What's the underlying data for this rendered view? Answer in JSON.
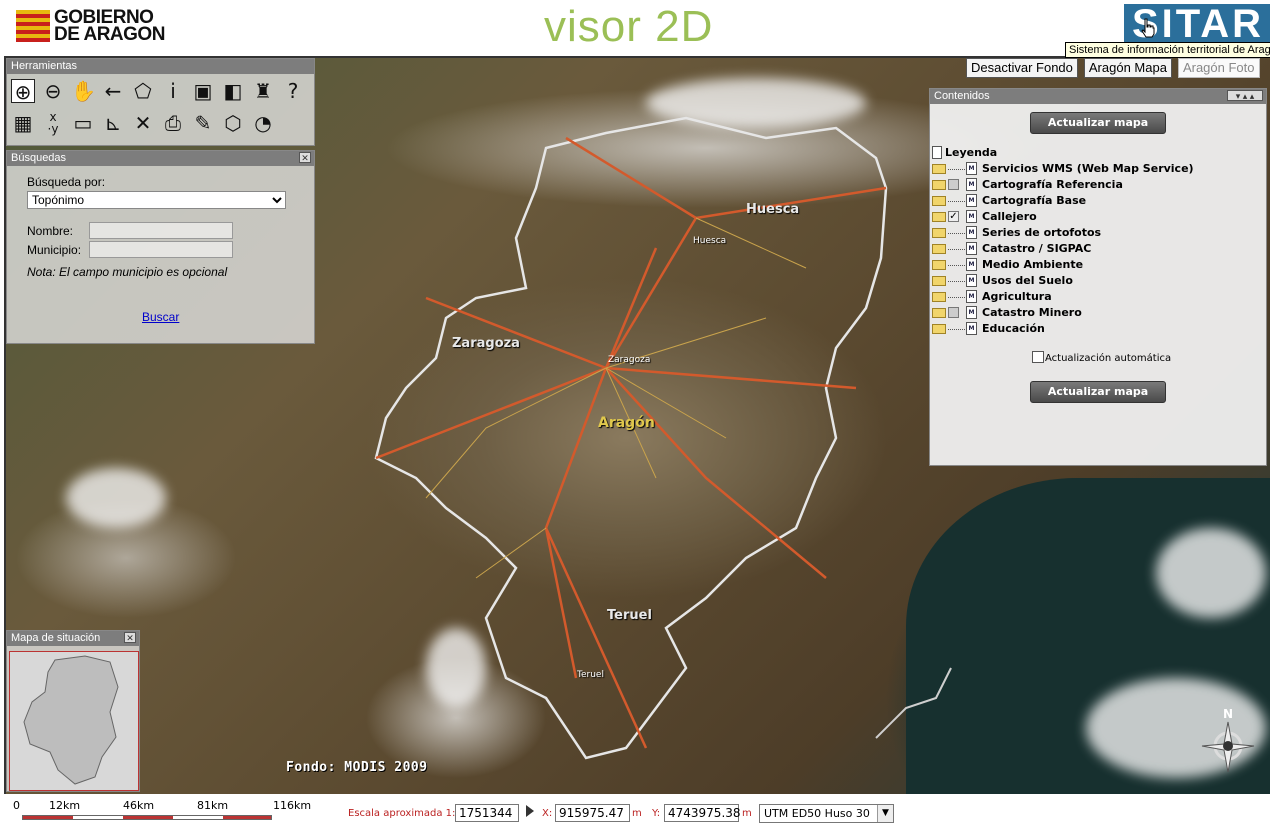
{
  "header": {
    "logo_line1": "GOBIERNO",
    "logo_line2": "DE ARAGON",
    "title": "visor 2D",
    "sitar_logo": "SITAR",
    "tooltip": "Sistema de información territorial de Aragón"
  },
  "layer_buttons": [
    "Desactivar Fondo",
    "Aragón Mapa",
    "Aragón Foto"
  ],
  "map": {
    "places": {
      "huesca_province": "Huesca",
      "huesca_city": "Huesca",
      "zaragoza_province": "Zaragoza",
      "zaragoza_city": "Zaragoza",
      "aragon": "Aragón",
      "teruel_province": "Teruel",
      "teruel_city": "Teruel"
    },
    "fondo": "Fondo: MODIS 2009",
    "north": "N"
  },
  "herramientas": {
    "title": "Herramientas",
    "tools": [
      "zoom-in-icon",
      "zoom-out-icon",
      "pan-hand-icon",
      "back-arrow-icon",
      "extent-icon",
      "info-icon",
      "save-icon",
      "overlay-icon",
      "binoculars-icon",
      "help-icon",
      "legend-icon",
      "coordinates-xy-icon",
      "measure-length-icon",
      "measure-area-icon",
      "clear-icon",
      "print-icon",
      "draw-pencil-icon",
      "select-polygon-icon",
      "compass-icon"
    ]
  },
  "busquedas": {
    "title": "Búsquedas",
    "busqueda_por": "Búsqueda por:",
    "selected": "Topónimo",
    "nombre": "Nombre:",
    "municipio": "Municipio:",
    "nota": "Nota: El campo municipio es opcional",
    "buscar": "Buscar"
  },
  "situacion": {
    "title": "Mapa de situación"
  },
  "contenidos": {
    "title": "Contenidos",
    "update": "Actualizar mapa",
    "leyenda": "Leyenda",
    "layers": [
      {
        "label": "Servicios WMS (Web Map Service)",
        "check": "none"
      },
      {
        "label": "Cartografía Referencia",
        "check": "empty"
      },
      {
        "label": "Cartografía Base",
        "check": "none"
      },
      {
        "label": "Callejero",
        "check": "checked"
      },
      {
        "label": "Series de ortofotos",
        "check": "none"
      },
      {
        "label": "Catastro / SIGPAC",
        "check": "none"
      },
      {
        "label": "Medio Ambiente",
        "check": "none"
      },
      {
        "label": "Usos del Suelo",
        "check": "none"
      },
      {
        "label": "Agricultura",
        "check": "none"
      },
      {
        "label": "Catastro Minero",
        "check": "empty"
      },
      {
        "label": "Educación",
        "check": "none"
      }
    ],
    "auto_update": "Actualización automática"
  },
  "status": {
    "scale_ticks": [
      "0",
      "12km",
      "46km",
      "81km",
      "116km"
    ],
    "escala_label": "Escala aproximada 1:",
    "escala_value": "1751344",
    "x_label": "X:",
    "x_value": "915975.47",
    "y_label": "Y:",
    "y_value": "4743975.38",
    "unit": "m",
    "crs": "UTM ED50 Huso 30"
  }
}
